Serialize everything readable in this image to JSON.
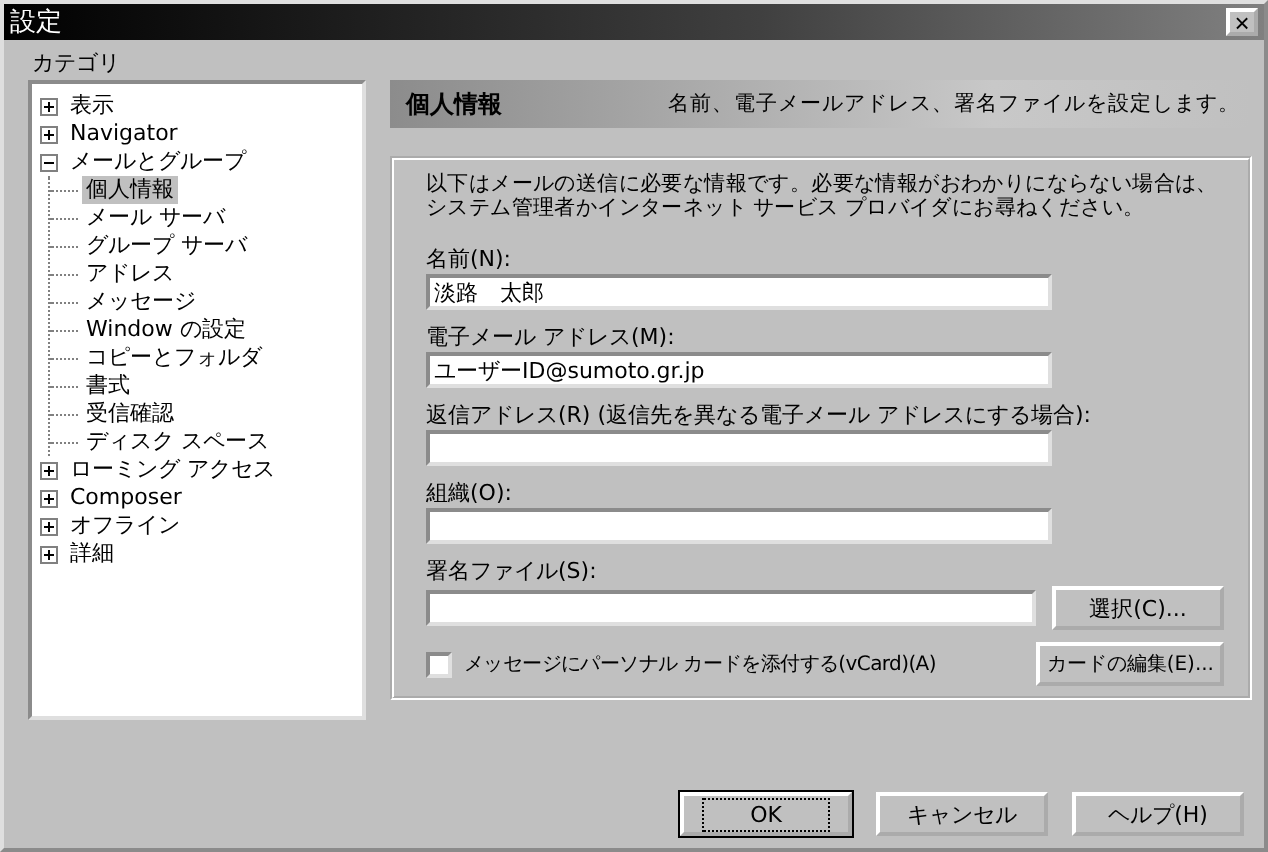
{
  "window": {
    "title": "設定",
    "close": "×"
  },
  "category_label": "カテゴリ",
  "tree": [
    {
      "label": "表示",
      "expanded": false,
      "selected": false
    },
    {
      "label": "Navigator",
      "expanded": false,
      "selected": false
    },
    {
      "label": "メールとグループ",
      "expanded": true,
      "selected": false,
      "children": [
        {
          "label": "個人情報",
          "selected": true
        },
        {
          "label": "メール サーバ",
          "selected": false
        },
        {
          "label": "グループ サーバ",
          "selected": false
        },
        {
          "label": "アドレス",
          "selected": false
        },
        {
          "label": "メッセージ",
          "selected": false
        },
        {
          "label": "Window の設定",
          "selected": false
        },
        {
          "label": "コピーとフォルダ",
          "selected": false
        },
        {
          "label": "書式",
          "selected": false
        },
        {
          "label": "受信確認",
          "selected": false
        },
        {
          "label": "ディスク スペース",
          "selected": false
        }
      ]
    },
    {
      "label": "ローミング アクセス",
      "expanded": false,
      "selected": false
    },
    {
      "label": "Composer",
      "expanded": false,
      "selected": false
    },
    {
      "label": "オフライン",
      "expanded": false,
      "selected": false
    },
    {
      "label": "詳細",
      "expanded": false,
      "selected": false
    }
  ],
  "header": {
    "title": "個人情報",
    "description": "名前、電子メールアドレス、署名ファイルを設定します。"
  },
  "intro": "以下はメールの送信に必要な情報です。必要な情報がおわかりにならない場合は、システム管理者かインターネット サービス プロバイダにお尋ねください。",
  "fields": [
    {
      "label": "名前(N):",
      "value": "淡路　太郎"
    },
    {
      "label": "電子メール アドレス(M):",
      "value": "ユーザーID@sumoto.gr.jp"
    },
    {
      "label": "返信アドレス(R) (返信先を異なる電子メール アドレスにする場合):"
    },
    {
      "label": "組織(O):"
    },
    {
      "label": "署名ファイル(S):",
      "button": "選択(C)..."
    }
  ],
  "vcard": {
    "label": "メッセージにパーソナル カードを添付する(vCard)(A)",
    "checked": false,
    "button": "カードの編集(E)..."
  },
  "buttons": [
    {
      "label": "OK",
      "default": true
    },
    {
      "label": "キャンセル",
      "default": false
    },
    {
      "label": "ヘルプ(H)",
      "default": false
    }
  ]
}
